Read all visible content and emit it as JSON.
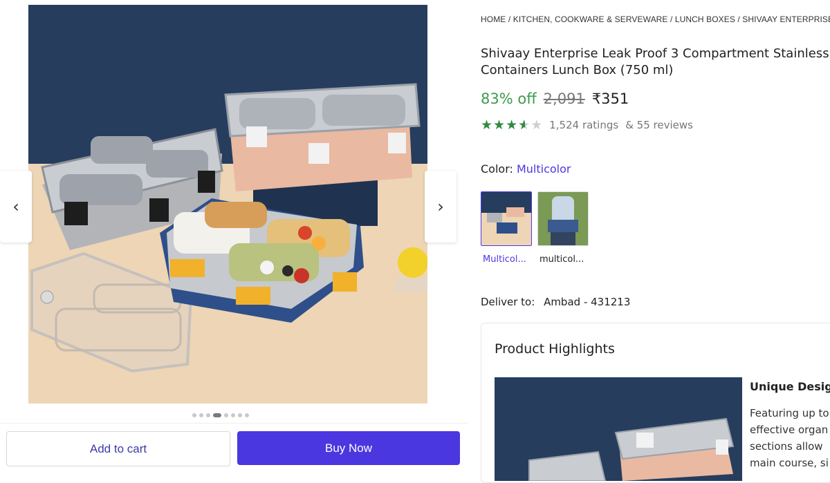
{
  "breadcrumb": [
    "HOME",
    "KITCHEN, COOKWARE & SERVEWARE",
    "LUNCH BOXES",
    "SHIVAAY ENTERPRISE LU"
  ],
  "product": {
    "title_line1": "Shivaay Enterprise Leak Proof 3 Compartment Stainless",
    "title_line2": "Containers Lunch Box (750 ml)",
    "discount": "83% off",
    "mrp": "2,091",
    "price": "₹351",
    "rating_value": 3.5,
    "ratings": "1,524 ratings",
    "reviews": "& 55 reviews"
  },
  "color": {
    "label": "Color:",
    "value": "Multicolor",
    "options": [
      {
        "label": "Multicol...",
        "selected": true
      },
      {
        "label": "multicol...",
        "selected": false
      }
    ]
  },
  "delivery": {
    "label": "Deliver to:",
    "location": "Ambad - 431213"
  },
  "highlights": {
    "title": "Product Highlights",
    "heading": "Unique Design",
    "text_lines": [
      "Featuring up to",
      "effective organ",
      "sections allow",
      "main course, si"
    ]
  },
  "gallery": {
    "image_count": 8,
    "active_index": 4
  },
  "actions": {
    "add_to_cart": "Add to cart",
    "buy_now": "Buy Now"
  },
  "colors": {
    "accent": "#4b37e0",
    "discount_green": "#3a9c4a",
    "star_green": "#2e8b3e"
  },
  "icons": {
    "prev": "chevron-left-icon",
    "next": "chevron-right-icon"
  }
}
